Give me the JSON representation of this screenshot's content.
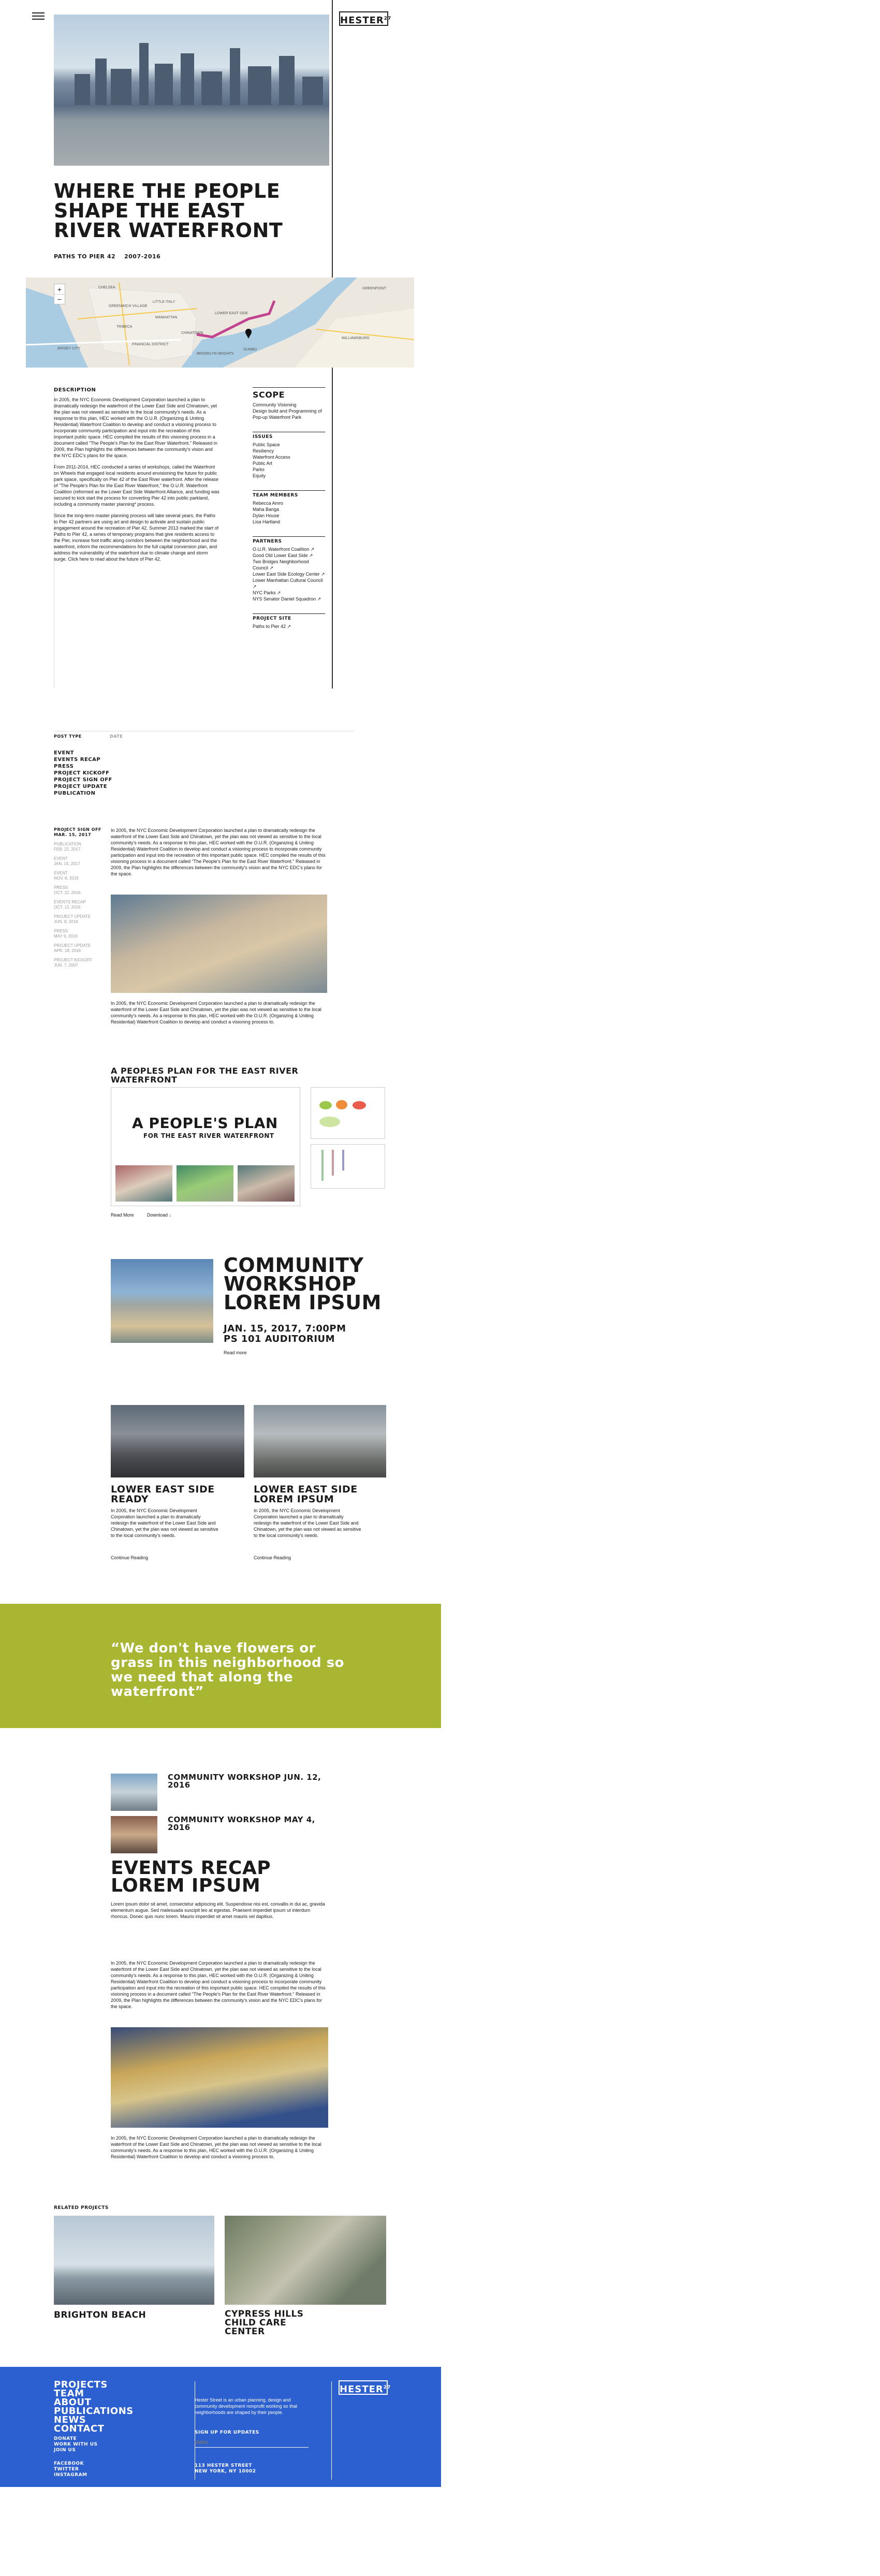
{
  "header": {
    "logo": "HESTER",
    "logo_sup": "27"
  },
  "hero": {
    "title": "WHERE THE PEOPLE SHAPE THE EAST RIVER WATERFRONT",
    "subtitle_left": "PATHS TO PIER 42",
    "subtitle_right": "2007-2016"
  },
  "map": {
    "zoom_in": "+",
    "zoom_out": "−",
    "labels": [
      "CHELSEA",
      "GREENWICH VILLAGE",
      "LITTLE ITALY",
      "MANHATTAN",
      "TRIBECA",
      "FINANCIAL DISTRICT",
      "CHINATOWN",
      "LOWER EAST SIDE",
      "BROOKLYN HEIGHTS",
      "DUMBO",
      "WILLIAMSBURG",
      "JERSEY CITY",
      "GREENPOINT"
    ]
  },
  "description": {
    "heading": "DESCRIPTION",
    "p1": "In 2005, the NYC Economic Development Corporation launched a plan to dramatically redesign the waterfront of the Lower East Side and Chinatown, yet the plan was not viewed as sensitive to the local community's needs. As a response to this plan, HEC worked with the O.U.R. (Organizing & Uniting Residential) Waterfront Coalition to develop and conduct a visioning process to incorporate community participation and input into the recreation of this important public space. HEC compiled the results of this visioning process in a document called \"The People's Plan for the East River Waterfront.\" Released in 2009, the Plan highlights the differences between the community's vision and the NYC EDC's plans for the space.",
    "p2": "From 2011-2014, HEC conducted a series of workshops, called the Waterfront on Wheels that engaged local residents around envisioning the future for public park space, specifically on Pier 42 of the East River waterfront. After the release of \"The People's Plan for the East River Waterfront,\" the O.U.R. Waterfront Coalition (reformed as the Lower East Side Waterfront Alliance, and funding was secured to kick start the process for converting Pier 42 into public parkland, including a community master planning* process.",
    "p3": "Since the long-term master planning process will take several years, the Paths to Pier 42 partners are using art and design to activate and sustain public engagement around the recreation of Pier 42. Summer 2013 marked the start of Paths to Pier 42, a series of temporary programs that give residents access to the Pier, increase foot traffic along corridors between the neighborhood and the waterfront, inform the recommendations for the full capital conversion plan, and address the vulnerability of the waterfront due to climate change and storm surge. Click here to read about the future of Pier 42."
  },
  "scope": {
    "heading": "SCOPE",
    "items": [
      "Community Visioning",
      "Design build and Programming of Pop-up Waterfront Park"
    ]
  },
  "issues": {
    "heading": "ISSUES",
    "items": [
      "Public Space",
      "Resiliency",
      "Waterfront Access",
      "Public Art",
      "Parks",
      "Equity"
    ]
  },
  "team": {
    "heading": "TEAM MEMBERS",
    "items": [
      "Rebecca Amro",
      "Maha Bariga",
      "Dylan House",
      "Lisa Hartland"
    ]
  },
  "partners": {
    "heading": "PARTNERS",
    "items": [
      "O.U.R. Waterfront Coalition ↗",
      "Good Old Lower East Side ↗",
      "Two Bridges Neighborhood Council ↗",
      "Lower East Side Ecology Center ↗",
      "Lower Manhattan Cultural Council ↗",
      "NYC Parks ↗",
      "NYS Senator Daniel Squadron ↗"
    ]
  },
  "project_site": {
    "heading": "PROJECT SITE",
    "link": "Paths to Pier 42 ↗"
  },
  "filters": {
    "post_type_label": "POST TYPE",
    "date_label": "DATE",
    "types": [
      "EVENT",
      "EVENTS RECAP",
      "PRESS",
      "PROJECT KICKOFF",
      "PROJECT SIGN OFF",
      "PROJECT UPDATE",
      "PUBLICATION"
    ]
  },
  "timeline": [
    {
      "type": "PROJECT SIGN OFF",
      "date": "MAR. 15, 2017",
      "active": true
    },
    {
      "type": "PUBLICATION",
      "date": "FEB. 22, 2017",
      "active": false
    },
    {
      "type": "EVENT",
      "date": "JAN. 15, 2017",
      "active": false
    },
    {
      "type": "EVENT",
      "date": "NOV. 8, 2016",
      "active": false
    },
    {
      "type": "PRESS",
      "date": "OCT. 22, 2016",
      "active": false
    },
    {
      "type": "EVENTS RECAP",
      "date": "OCT. 12, 2016",
      "active": false
    },
    {
      "type": "PROJECT UPDATE",
      "date": "JUN. 8, 2016",
      "active": false
    },
    {
      "type": "PRESS",
      "date": "MAY 9, 2016",
      "active": false
    },
    {
      "type": "PROJECT UPDATE",
      "date": "APR. 18, 2016",
      "active": false
    },
    {
      "type": "PROJECT KICKOFF",
      "date": "JUN. 7, 2007",
      "active": false
    }
  ],
  "post1": {
    "text1": "In 2005, the NYC Economic Development Corporation launched a plan to dramatically redesign the waterfront of the Lower East Side and Chinatown, yet the plan was not viewed as sensitive to the local community's needs. As a response to this plan, HEC worked with the O.U.R. (Organizing & Uniting Residential) Waterfront Coalition to develop and conduct a visioning process to incorporate community participation and input into the recreation of this important public space. HEC compiled the results of this visioning process in a document called \"The People's Plan for the East River Waterfront.\" Released in 2009, the Plan highlights the differences between the community's vision and the NYC EDC's plans for the space.",
    "text2": "In 2005, the NYC Economic Development Corporation launched a plan to dramatically redesign the waterfront of the Lower East Side and Chinatown, yet the plan was not viewed as sensitive to the local community's needs. As a response to this plan, HEC worked with the O.U.R. (Organizing & Uniting Residential) Waterfront Coalition to develop and conduct a visioning process to."
  },
  "publication": {
    "title": "A PEOPLES PLAN FOR THE EAST RIVER WATERFRONT",
    "cover_line1": "A PEOPLE'S PLAN",
    "cover_line2": "FOR THE EAST RIVER WATERFRONT",
    "read_more": "Read More",
    "download": "Download ↓"
  },
  "event": {
    "title": "COMMUNITY WORKSHOP LOREM IPSUM",
    "date": "JAN. 15, 2017, 7:00PM",
    "place": "PS 101 AUDITORIUM",
    "read_more": "Read more"
  },
  "press": [
    {
      "title": "LOWER EAST SIDE READY",
      "text": "In 2005, the NYC Economic Development Corporation launched a plan to dramatically redesign the waterfront of the Lower East Side and Chinatown, yet the plan was not viewed as sensitive to the local community's needs.",
      "link": "Continue Reading"
    },
    {
      "title": "LOWER EAST SIDE LOREM IPSUM",
      "text": "In 2005, the NYC Economic Development Corporation launched a plan to dramatically redesign the waterfront of the Lower East Side and Chinatown, yet the plan was not viewed as sensitive to the local community's needs.",
      "link": "Continue Reading"
    }
  ],
  "quote": "“We don't have flowers or grass in this neighborhood so we need that along the waterfront”",
  "recaps": [
    {
      "title": "COMMUNITY WORKSHOP JUN. 12, 2016"
    },
    {
      "title": "COMMUNITY WORKSHOP MAY 4, 2016"
    }
  ],
  "events_recap": {
    "title": "EVENTS RECAP LOREM IPSUM",
    "lede": "Lorem ipsum dolor sit amet, consectetur adipiscing elit. Suspendisse nisi est, convallis in dui ac, gravida elementum augue. Sed malesuada suscipit leo at egestas. Praesent imperdiet ipsum ut interdum rhoncus. Donec quis nunc lorem. Mauris imperdiet sit amet mauris vel dapibus.",
    "text1": "In 2005, the NYC Economic Development Corporation launched a plan to dramatically redesign the waterfront of the Lower East Side and Chinatown, yet the plan was not viewed as sensitive to the local community's needs. As a response to this plan, HEC worked with the O.U.R. (Organizing & Uniting Residential) Waterfront Coalition to develop and conduct a visioning process to incorporate community participation and input into the recreation of this important public space. HEC compiled the results of this visioning process in a document called \"The People's Plan for the East River Waterfront.\" Released in 2009, the Plan highlights the differences between the community's vision and the NYC EDC's plans for the space.",
    "text2": "In 2005, the NYC Economic Development Corporation launched a plan to dramatically redesign the waterfront of the Lower East Side and Chinatown, yet the plan was not viewed as sensitive to the local community's needs. As a response to this plan, HEC worked with the O.U.R. (Organizing & Uniting Residential) Waterfront Coalition to develop and conduct a visioning process to."
  },
  "related": {
    "heading": "RELATED PROJECTS",
    "items": [
      {
        "title": "BRIGHTON BEACH"
      },
      {
        "title": "CYPRESS HILLS CHILD CARE CENTER"
      }
    ]
  },
  "footer": {
    "nav": [
      "PROJECTS",
      "TEAM",
      "ABOUT",
      "PUBLICATIONS",
      "NEWS",
      "CONTACT"
    ],
    "secondary": [
      "DONATE",
      "WORK WITH US",
      "JOIN US"
    ],
    "social": [
      "FACEBOOK",
      "TWITTER",
      "INSTAGRAM"
    ],
    "logo": "HESTER",
    "logo_sup": "27",
    "blurb": "Hester Street is an urban planning, design and community development nonprofit working so that neighborhoods are shaped by their people.",
    "signup": "SIGN UP FOR UPDATES",
    "email_placeholder": "EMAIL",
    "address1": "113 HESTER STREET",
    "address2": "NEW YORK, NY 10002"
  },
  "colors": {
    "quote_band": "#a9b631",
    "footer_blue": "#2c5fcf",
    "map_route": "#c2448f"
  }
}
